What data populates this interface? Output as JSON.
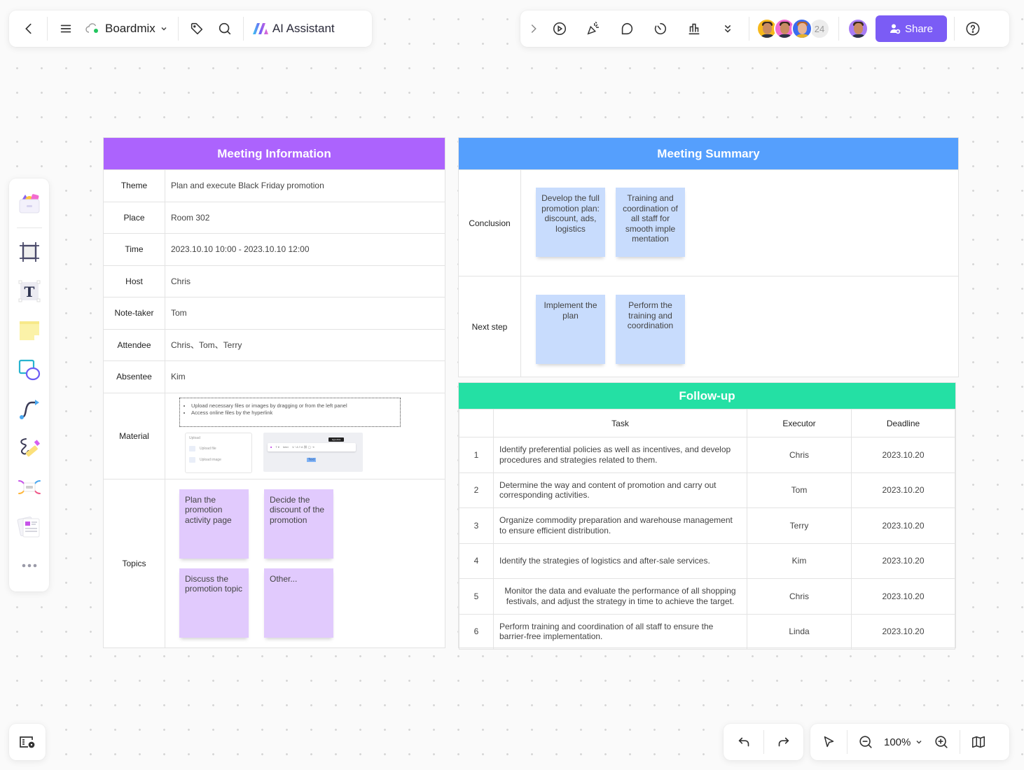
{
  "toolbar_left": {
    "back_icon": "chevron-left-icon",
    "menu_icon": "hamburger-menu-icon",
    "doc_name": "Boardmix",
    "sync_status_color": "#22c55e",
    "tag_icon": "tag-icon",
    "search_icon": "search-icon",
    "ai_assistant_label": "AI Assistant"
  },
  "toolbar_right": {
    "icons": [
      "chevron-right-icon",
      "play-icon",
      "celebrate-icon",
      "comment-icon",
      "timer-icon",
      "vote-icon",
      "more-chevrons-icon"
    ],
    "collaborators": [
      {
        "name": "collaborator-1",
        "bg": "#f7b91c"
      },
      {
        "name": "collaborator-2",
        "bg": "#f36bd1"
      },
      {
        "name": "collaborator-3",
        "bg": "#3c6cf0"
      }
    ],
    "collaborator_count": "24",
    "current_user_bg": "#a77cf5",
    "share_label": "Share",
    "share_color": "#7b5cf5",
    "help_icon": "help-icon"
  },
  "left_tools": [
    "template-icon",
    "frame-icon",
    "text-icon",
    "sticky-note-icon",
    "shape-icon",
    "connector-icon",
    "pen-icon",
    "mindmap-icon",
    "document-icon",
    "more-icon"
  ],
  "meeting_info": {
    "title": "Meeting Information",
    "header_color": "#ac63fd",
    "rows": [
      {
        "label": "Theme",
        "value": "Plan and execute Black Friday promotion"
      },
      {
        "label": "Place",
        "value": "Room 302"
      },
      {
        "label": "Time",
        "value": "2023.10.10 10:00 - 2023.10.10 12:00"
      },
      {
        "label": "Host",
        "value": "Chris"
      },
      {
        "label": "Note-taker",
        "value": "Tom"
      },
      {
        "label": "Attendee",
        "value": "Chris、Tom、Terry"
      },
      {
        "label": "Absentee",
        "value": "Kim"
      }
    ],
    "material": {
      "label": "Material",
      "bullets": [
        "Upload necessary files or images by dragging or from the left panel",
        "Access online files by the hyperlink"
      ],
      "upload_panel": {
        "title": "Upload",
        "items": [
          "Upload file",
          "Upload image"
        ]
      },
      "editor_preview": {
        "tooltip": "Hyperlink",
        "text": "Text"
      }
    },
    "topics": {
      "label": "Topics",
      "notes": [
        "Plan the promotion activity page",
        "Decide the discount of the promotion",
        "Discuss the promotion topic",
        "Other..."
      ]
    }
  },
  "meeting_summary": {
    "title": "Meeting Summary",
    "header_color": "#559ffd",
    "conclusion": {
      "label": "Conclusion",
      "notes": [
        "Develop the full promotion plan: discount, ads, logistics",
        "Training and coordination of all staff for smooth imple mentation"
      ]
    },
    "next_step": {
      "label": "Next step",
      "notes": [
        "Implement the plan",
        "Perform the training and coordination"
      ]
    }
  },
  "follow_up": {
    "title": "Follow-up",
    "header_color": "#24e0a4",
    "columns": [
      "",
      "Task",
      "Executor",
      "Deadline"
    ],
    "rows": [
      {
        "no": "1",
        "task": "Identify preferential policies as well as incentives, and develop procedures and strategies related to them.",
        "executor": "Chris",
        "deadline": "2023.10.20"
      },
      {
        "no": "2",
        "task": "Determine the way and content of promotion and carry out corresponding activities.",
        "executor": "Tom",
        "deadline": "2023.10.20"
      },
      {
        "no": "3",
        "task": "Organize commodity preparation and warehouse management to ensure efficient distribution.",
        "executor": "Terry",
        "deadline": "2023.10.20"
      },
      {
        "no": "4",
        "task": "Identify the strategies of logistics and after-sale services.",
        "executor": "Kim",
        "deadline": "2023.10.20"
      },
      {
        "no": "5",
        "task": "Monitor the data and evaluate the performance of all shopping festivals, and adjust the strategy in time to achieve the target.",
        "executor": "Chris",
        "deadline": "2023.10.20"
      },
      {
        "no": "6",
        "task": "Perform training and coordination of all staff to ensure the barrier-free implementation.",
        "executor": "Linda",
        "deadline": "2023.10.20"
      }
    ]
  },
  "bottom": {
    "minimap_toggle_icon": "location-card-icon",
    "undo_icon": "undo-icon",
    "redo_icon": "redo-icon",
    "select_icon": "pointer-icon",
    "zoom_out_icon": "zoom-out-icon",
    "zoom_level": "100%",
    "zoom_in_icon": "zoom-in-icon",
    "map_icon": "map-icon"
  }
}
